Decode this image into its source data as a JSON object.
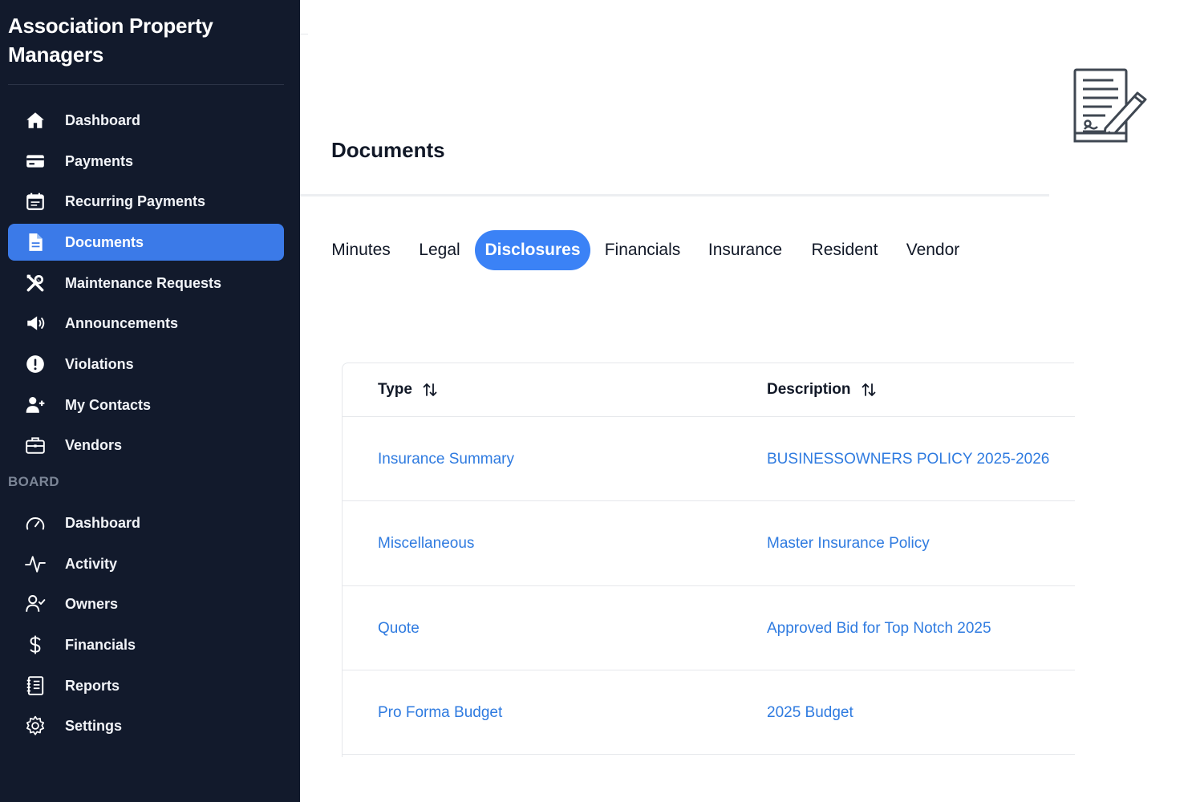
{
  "app": {
    "title": "Association Property Managers"
  },
  "sidebar": {
    "items": [
      {
        "label": "Dashboard",
        "icon": "home-icon"
      },
      {
        "label": "Payments",
        "icon": "credit-card-icon"
      },
      {
        "label": "Recurring Payments",
        "icon": "calendar-icon"
      },
      {
        "label": "Documents",
        "icon": "document-icon",
        "active": true
      },
      {
        "label": "Maintenance Requests",
        "icon": "tools-icon"
      },
      {
        "label": "Announcements",
        "icon": "megaphone-icon"
      },
      {
        "label": "Violations",
        "icon": "alert-circle-icon"
      },
      {
        "label": "My Contacts",
        "icon": "user-plus-icon"
      },
      {
        "label": "Vendors",
        "icon": "briefcase-icon"
      }
    ],
    "board_label": "BOARD",
    "board_items": [
      {
        "label": "Dashboard",
        "icon": "gauge-icon"
      },
      {
        "label": "Activity",
        "icon": "activity-icon"
      },
      {
        "label": "Owners",
        "icon": "user-check-icon"
      },
      {
        "label": "Financials",
        "icon": "dollar-icon"
      },
      {
        "label": "Reports",
        "icon": "notebook-icon"
      },
      {
        "label": "Settings",
        "icon": "gear-icon"
      }
    ]
  },
  "main": {
    "title": "Documents",
    "tabs": [
      {
        "label": "Minutes"
      },
      {
        "label": "Legal"
      },
      {
        "label": "Disclosures",
        "active": true
      },
      {
        "label": "Financials"
      },
      {
        "label": "Insurance"
      },
      {
        "label": "Resident"
      },
      {
        "label": "Vendor"
      }
    ],
    "table": {
      "columns": [
        "Type",
        "Description"
      ],
      "rows": [
        {
          "type": "Insurance Summary",
          "description": "BUSINESSOWNERS POLICY 2025-2026"
        },
        {
          "type": "Miscellaneous",
          "description": "Master Insurance Policy"
        },
        {
          "type": "Quote",
          "description": "Approved Bid for Top Notch 2025"
        },
        {
          "type": "Pro Forma Budget",
          "description": "2025 Budget"
        }
      ]
    }
  },
  "colors": {
    "sidebar_bg": "#121a2c",
    "active_nav": "#3b7ae8",
    "active_tab": "#3b82f6",
    "link": "#2f7be0"
  }
}
